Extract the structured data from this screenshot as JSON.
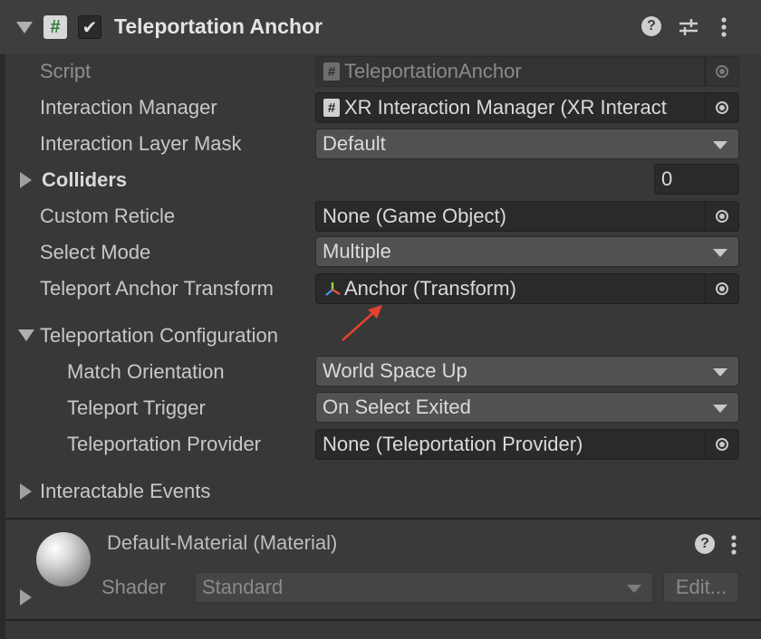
{
  "component": {
    "title": "Teleportation Anchor",
    "enabled": true,
    "fields": {
      "script": {
        "label": "Script",
        "value": "TeleportationAnchor"
      },
      "interaction_manager": {
        "label": "Interaction Manager",
        "value": "XR Interaction Manager (XR Interact"
      },
      "interaction_layer_mask": {
        "label": "Interaction Layer Mask",
        "value": "Default"
      },
      "colliders": {
        "label": "Colliders",
        "value": "0"
      },
      "custom_reticle": {
        "label": "Custom Reticle",
        "value": "None (Game Object)"
      },
      "select_mode": {
        "label": "Select Mode",
        "value": "Multiple"
      },
      "teleport_anchor_transform": {
        "label": "Teleport Anchor Transform",
        "value": "Anchor (Transform)"
      }
    },
    "teleportation_configuration": {
      "label": "Teleportation Configuration",
      "match_orientation": {
        "label": "Match Orientation",
        "value": "World Space Up"
      },
      "teleport_trigger": {
        "label": "Teleport Trigger",
        "value": "On Select Exited"
      },
      "teleportation_provider": {
        "label": "Teleportation Provider",
        "value": "None (Teleportation Provider)"
      }
    },
    "interactable_events": {
      "label": "Interactable Events"
    }
  },
  "material": {
    "title": "Default-Material (Material)",
    "shader_label": "Shader",
    "shader_value": "Standard",
    "edit_label": "Edit..."
  },
  "colors": {
    "annotation_arrow": "#e8412c",
    "script_icon": "#2f7a3a"
  }
}
